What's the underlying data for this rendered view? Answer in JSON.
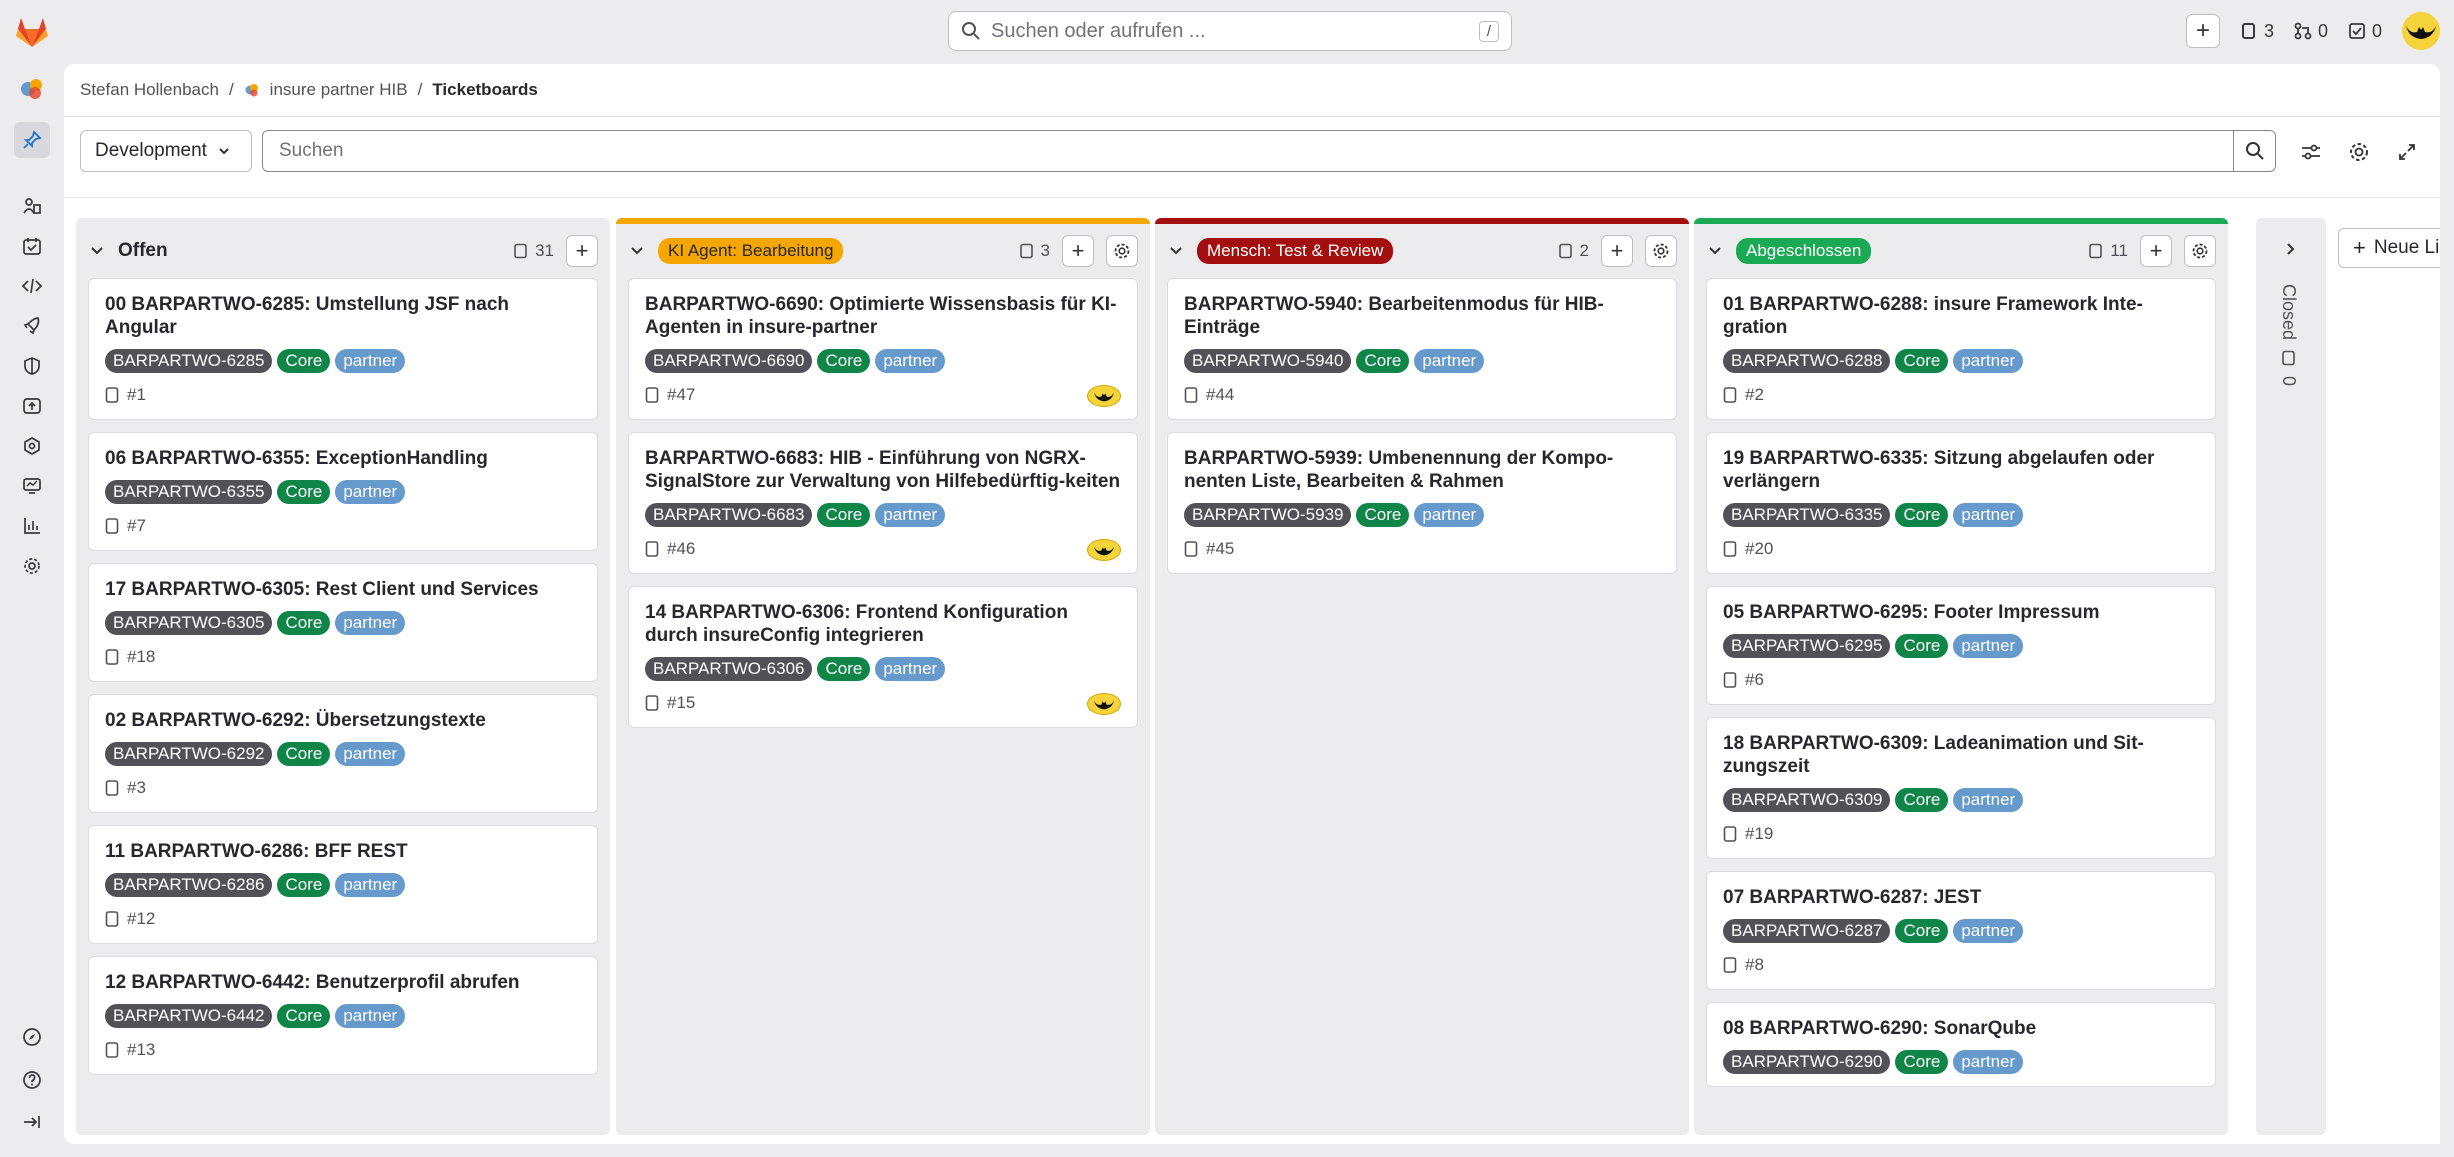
{
  "topbar": {
    "search_placeholder": "Suchen oder aufrufen ...",
    "search_shortcut": "/",
    "issues_count": "3",
    "merge_requests_count": "0",
    "todos_count": "0"
  },
  "breadcrumb": {
    "user": "Stefan Hollenbach",
    "project": "insure partner HIB",
    "page": "Ticketboards",
    "sep": "/"
  },
  "filter": {
    "board_select": "Development",
    "search_placeholder": "Suchen"
  },
  "columns": [
    {
      "title": "Offen",
      "label_color": "",
      "count": "31",
      "cards": [
        {
          "title": "00 BARPARTWO-6285: Umstellung JSF nach Angular",
          "key": "BARPARTWO-6285",
          "core": "Core",
          "partner": "partner",
          "ref": "#1"
        },
        {
          "title": "06 BARPARTWO-6355: ExceptionHandling",
          "key": "BARPARTWO-6355",
          "core": "Core",
          "partner": "partner",
          "ref": "#7"
        },
        {
          "title": "17 BARPARTWO-6305: Rest Client und Services",
          "key": "BARPARTWO-6305",
          "core": "Core",
          "partner": "partner",
          "ref": "#18"
        },
        {
          "title": "02 BARPARTWO-6292: Übersetzungstexte",
          "key": "BARPARTWO-6292",
          "core": "Core",
          "partner": "partner",
          "ref": "#3"
        },
        {
          "title": "11 BARPARTWO-6286: BFF REST",
          "key": "BARPARTWO-6286",
          "core": "Core",
          "partner": "partner",
          "ref": "#12"
        },
        {
          "title": "12 BARPARTWO-6442: Benutzerprofil abrufen",
          "key": "BARPARTWO-6442",
          "core": "Core",
          "partner": "partner",
          "ref": "#13"
        }
      ]
    },
    {
      "title": "KI Agent: Bearbeitung",
      "label_color": "#f5a600",
      "count": "3",
      "cards": [
        {
          "title": "BARPARTWO-6690: Optimierte Wissensbasis für KI-Agenten in insure-partner",
          "key": "BARPARTWO-6690",
          "core": "Core",
          "partner": "partner",
          "ref": "#47"
        },
        {
          "title": "BARPARTWO-6683: HIB - Einführung von NGRX-SignalStore zur Verwaltung von Hilfebedürftig-keiten",
          "key": "BARPARTWO-6683",
          "core": "Core",
          "partner": "partner",
          "ref": "#46"
        },
        {
          "title": "14 BARPARTWO-6306: Frontend Konfiguration durch insureConfig integrieren",
          "key": "BARPARTWO-6306",
          "core": "Core",
          "partner": "partner",
          "ref": "#15"
        }
      ]
    },
    {
      "title": "Mensch: Test & Review",
      "label_color": "#a30f0f",
      "count": "2",
      "cards": [
        {
          "title": "BARPARTWO-5940: Bearbeitenmodus für HIB-Einträge",
          "key": "BARPARTWO-5940",
          "core": "Core",
          "partner": "partner",
          "ref": "#44"
        },
        {
          "title": "BARPARTWO-5939: Umbenennung der Kompo-nenten Liste, Bearbeiten & Rahmen",
          "key": "BARPARTWO-5939",
          "core": "Core",
          "partner": "partner",
          "ref": "#45"
        }
      ]
    },
    {
      "title": "Abgeschlossen",
      "label_color": "#1aaa55",
      "count": "11",
      "cards": [
        {
          "title": "01 BARPARTWO-6288: insure Framework Inte-gration",
          "key": "BARPARTWO-6288",
          "core": "Core",
          "partner": "partner",
          "ref": "#2"
        },
        {
          "title": "19 BARPARTWO-6335: Sitzung abgelaufen oder verlängern",
          "key": "BARPARTWO-6335",
          "core": "Core",
          "partner": "partner",
          "ref": "#20"
        },
        {
          "title": "05 BARPARTWO-6295: Footer Impressum",
          "key": "BARPARTWO-6295",
          "core": "Core",
          "partner": "partner",
          "ref": "#6"
        },
        {
          "title": "18 BARPARTWO-6309: Ladeanimation und Sit-zungszeit",
          "key": "BARPARTWO-6309",
          "core": "Core",
          "partner": "partner",
          "ref": "#19"
        },
        {
          "title": "07 BARPARTWO-6287: JEST",
          "key": "BARPARTWO-6287",
          "core": "Core",
          "partner": "partner",
          "ref": "#8"
        },
        {
          "title": "08 BARPARTWO-6290: SonarQube",
          "key": "BARPARTWO-6290",
          "core": "Core",
          "partner": "partner",
          "ref": ""
        }
      ]
    }
  ],
  "closed": {
    "label": "Closed",
    "count": "0"
  },
  "new_list_label": "Neue Lis",
  "colors": {
    "accent": "#1f75cb",
    "core": "#108548",
    "partner": "#6699cc",
    "key": "#535158"
  }
}
